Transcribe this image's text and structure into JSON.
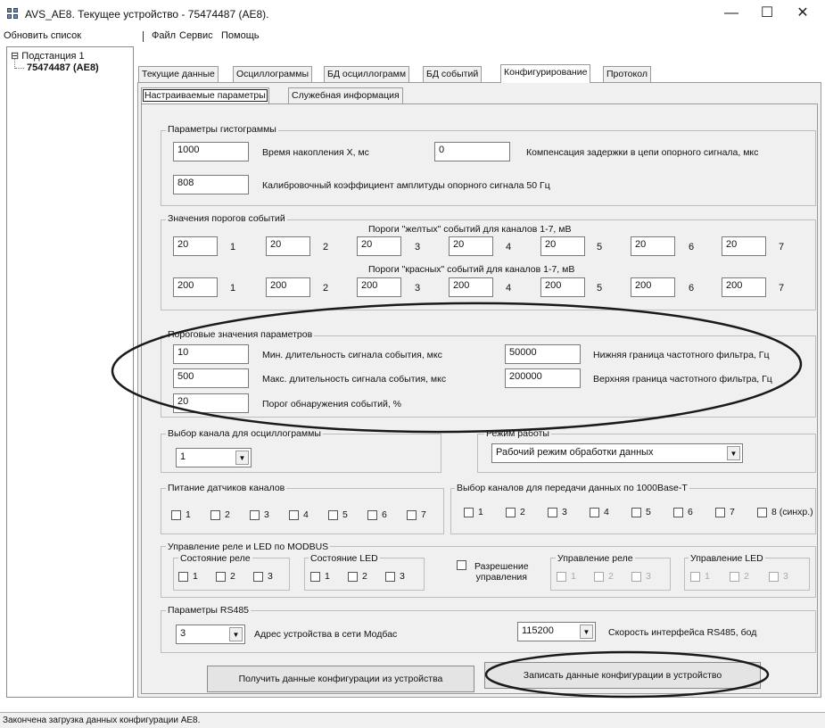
{
  "window": {
    "title": "AVS_AE8. Текущее устройство - 75474487 (AE8).",
    "controls": {
      "minimize": "—",
      "maximize": "☐",
      "close": "✕"
    }
  },
  "menu": {
    "refresh": "Обновить список",
    "file": "Файл",
    "service": "Сервис",
    "help": "Помощь"
  },
  "tree": {
    "root": "Подстанция 1",
    "child": "75474487 (AE8)",
    "root_toggle": "⊟"
  },
  "tabs": [
    {
      "label": "Текущие данные"
    },
    {
      "label": "Осциллограммы"
    },
    {
      "label": "БД осциллограмм"
    },
    {
      "label": "БД событий"
    },
    {
      "label": "Конфигурирование"
    },
    {
      "label": "Протокол"
    }
  ],
  "subtabs": [
    {
      "label": "Настраиваемые параметры"
    },
    {
      "label": "Служебная информация"
    }
  ],
  "histogram": {
    "title": "Параметры гистограммы",
    "accum_value": "1000",
    "accum_label": "Время накопления X, мс",
    "comp_value": "0",
    "comp_label": "Компенсация задержки в цепи опорного сигнала, мкс",
    "calib_value": "808",
    "calib_label": "Калибровочный коэффициент амплитуды опорного сигнала 50 Гц"
  },
  "thresholds": {
    "title": "Значения порогов событий",
    "yellow_label": "Пороги \"желтых\" событий для каналов 1-7, мВ",
    "red_label": "Пороги \"красных\" событий для каналов 1-7, мВ",
    "yellow": [
      "20",
      "20",
      "20",
      "20",
      "20",
      "20",
      "20"
    ],
    "red": [
      "200",
      "200",
      "200",
      "200",
      "200",
      "200",
      "200"
    ],
    "channels": [
      "1",
      "2",
      "3",
      "4",
      "5",
      "6",
      "7"
    ]
  },
  "params": {
    "title": "Пороговые значения параметров",
    "min_value": "10",
    "min_label": "Мин. длительность сигнала события, мкс",
    "max_value": "500",
    "max_label": "Макс. длительность сигнала события, мкс",
    "detect_value": "20",
    "detect_label": "Порог обнаружения событий, %",
    "low_value": "50000",
    "low_label": "Нижняя граница частотного фильтра, Гц",
    "high_value": "200000",
    "high_label": "Верхняя граница частотного фильтра, Гц"
  },
  "osc_channel": {
    "title": "Выбор канала для осциллограммы",
    "value": "1"
  },
  "mode": {
    "title": "Режим работы",
    "value": "Рабочий режим обработки данных"
  },
  "power": {
    "title": "Питание датчиков каналов",
    "channels": [
      "1",
      "2",
      "3",
      "4",
      "5",
      "6",
      "7"
    ]
  },
  "transfer": {
    "title": "Выбор каналов для передачи данных по 1000Base-T",
    "channels": [
      "1",
      "2",
      "3",
      "4",
      "5",
      "6",
      "7",
      "8 (синхр.)"
    ]
  },
  "modbus": {
    "title": "Управление реле и LED по MODBUS",
    "relay_state_label": "Состояние реле",
    "led_state_label": "Состояние LED",
    "allow_label_1": "Разрешение",
    "allow_label_2": "управления",
    "relay_ctrl_label": "Управление реле",
    "led_ctrl_label": "Управление LED",
    "items": [
      "1",
      "2",
      "3"
    ]
  },
  "rs485": {
    "title": "Параметры RS485",
    "addr_value": "3",
    "addr_label": "Адрес устройства в сети Модбас",
    "speed_value": "115200",
    "speed_label": "Скорость интерфейса RS485, бод"
  },
  "buttons": {
    "get_config": "Получить данные конфигурации из устройства",
    "write_config": "Записать данные конфигурации в устройство"
  },
  "status": "Закончена загрузка данных конфигурации AE8.",
  "icons": {
    "dropdown": "▼"
  },
  "colors": {
    "annotation_oval": "#1a1a1a",
    "panel_bg": "#f0f0f0"
  }
}
